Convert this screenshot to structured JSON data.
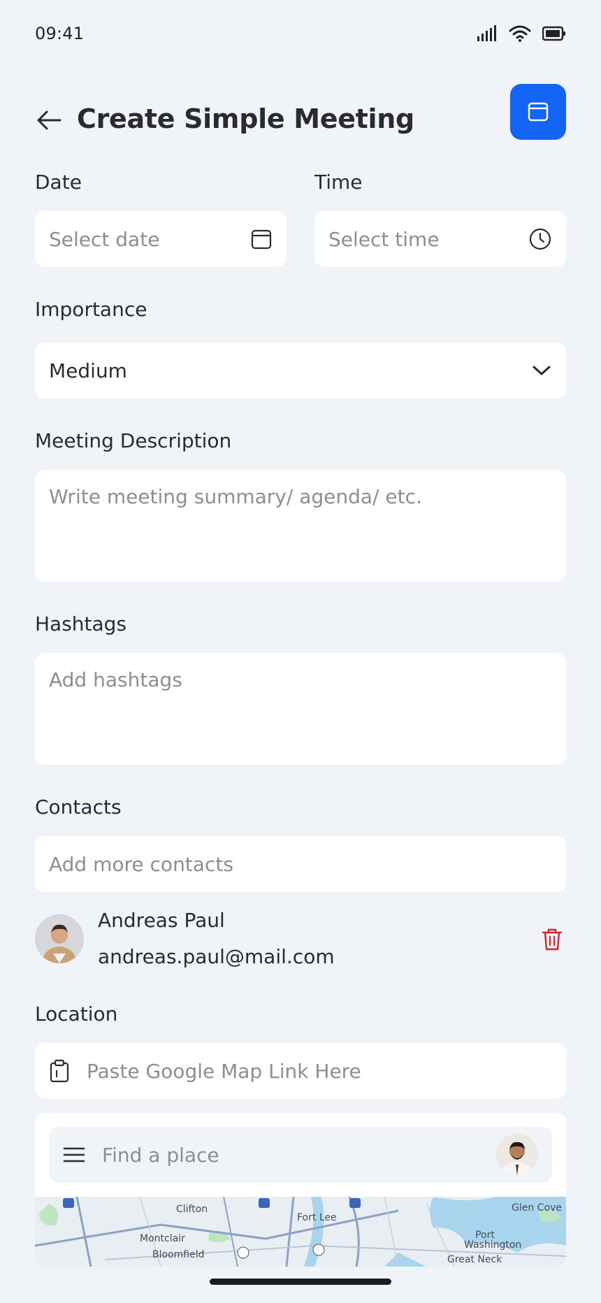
{
  "status_bar": {
    "time": "09:41"
  },
  "header": {
    "title": "Create Simple Meeting"
  },
  "date": {
    "label": "Date",
    "placeholder": "Select date"
  },
  "time": {
    "label": "Time",
    "placeholder": "Select time"
  },
  "importance": {
    "label": "Importance",
    "value": "Medium"
  },
  "description": {
    "label": "Meeting Description",
    "placeholder": "Write meeting summary/ agenda/ etc."
  },
  "hashtags": {
    "label": "Hashtags",
    "placeholder": "Add hashtags"
  },
  "contacts": {
    "label": "Contacts",
    "placeholder": "Add more contacts",
    "items": [
      {
        "name": "Andreas Paul",
        "email": "andreas.paul@mail.com"
      }
    ]
  },
  "location": {
    "label": "Location",
    "placeholder": "Paste Google Map Link Here",
    "map_search_placeholder": "Find a place",
    "map_labels": [
      "Clifton",
      "Fort Lee",
      "Glen Cove",
      "Montclair",
      "Port Washington",
      "Bloomfield",
      "Great Neck"
    ]
  },
  "colors": {
    "accent": "#1464f6",
    "background": "#f0f3f8",
    "delete": "#d3262b"
  },
  "icons": {
    "back": "arrow-left-icon",
    "header_action": "window-icon",
    "date": "calendar-icon",
    "time": "clock-icon",
    "importance": "chevron-down-icon",
    "delete": "trash-icon",
    "paste": "clipboard-icon",
    "menu": "hamburger-icon"
  }
}
